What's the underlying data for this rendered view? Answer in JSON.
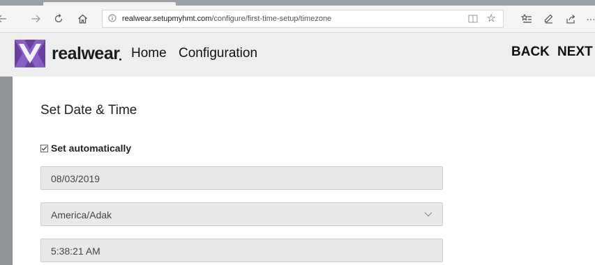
{
  "browser": {
    "url_host": "realwear.setupmyhmt.com",
    "url_path": "/configure/first-time-setup/timezone",
    "icons": [
      "back-arrow-icon",
      "forward-arrow-icon",
      "refresh-icon",
      "home-icon",
      "info-icon",
      "reading-view-icon",
      "star-icon",
      "favorites-icon",
      "pen-icon",
      "share-icon",
      "more-icon"
    ]
  },
  "header": {
    "brand": "realwear",
    "nav": [
      "Home",
      "Configuration"
    ],
    "back_label": "BACK",
    "next_label": "NEXT",
    "brand_color": "#6b3fa0"
  },
  "main": {
    "title": "Set Date & Time",
    "auto_label": "Set automatically",
    "auto_checked": true,
    "date_value": "08/03/2019",
    "timezone_value": "America/Adak",
    "time_value": "5:38:21 AM"
  }
}
